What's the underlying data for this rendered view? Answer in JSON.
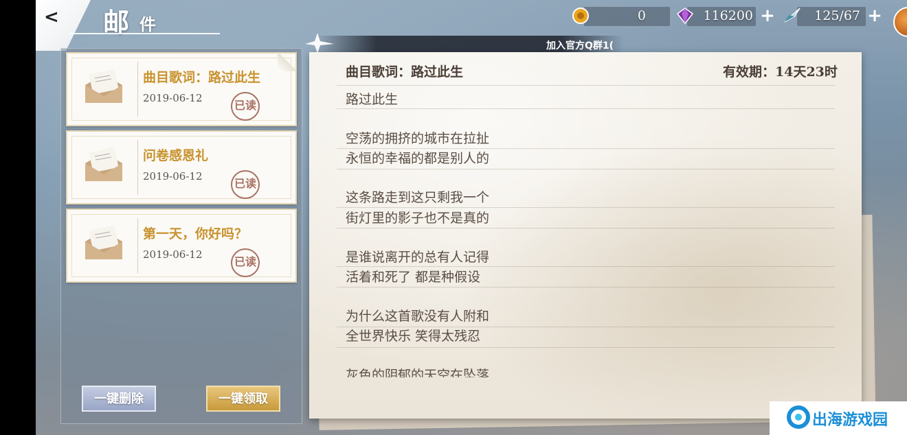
{
  "header": {
    "title_main": "邮",
    "title_sub": "件"
  },
  "currencies": {
    "gold": "0",
    "gems": "116200",
    "stamina": "125/67"
  },
  "notice": {
    "text": "加入官方Q群1("
  },
  "mail_list": [
    {
      "title": "曲目歌词：路过此生",
      "date": "2019-06-12",
      "status": "已读"
    },
    {
      "title": "问卷感恩礼",
      "date": "2019-06-12",
      "status": "已读"
    },
    {
      "title": "第一天，你好吗？",
      "date": "2019-06-12",
      "status": "已读"
    }
  ],
  "buttons": {
    "delete_all": "一键删除",
    "claim_all": "一键领取"
  },
  "letter": {
    "title": "曲目歌词：路过此生",
    "expiry": "有效期：14天23时",
    "lines": [
      "路过此生",
      "空荡的拥挤的城市在拉扯",
      "永恒的幸福的都是别人的",
      "这条路走到这只剩我一个",
      "街灯里的影子也不是真的",
      "是谁说离开的总有人记得",
      "活着和死了  都是种假设",
      "为什么这首歌没有人附和",
      "全世界快乐  笑得太残忍",
      "灰色的阴郁的天空在坠落"
    ]
  },
  "watermark": {
    "text": "出海游戏园"
  },
  "colors": {
    "mail_title": "#c9922e",
    "delete_button": "#98a5c6",
    "claim_button": "#c89a3a",
    "letter_text": "#5a4e45"
  }
}
